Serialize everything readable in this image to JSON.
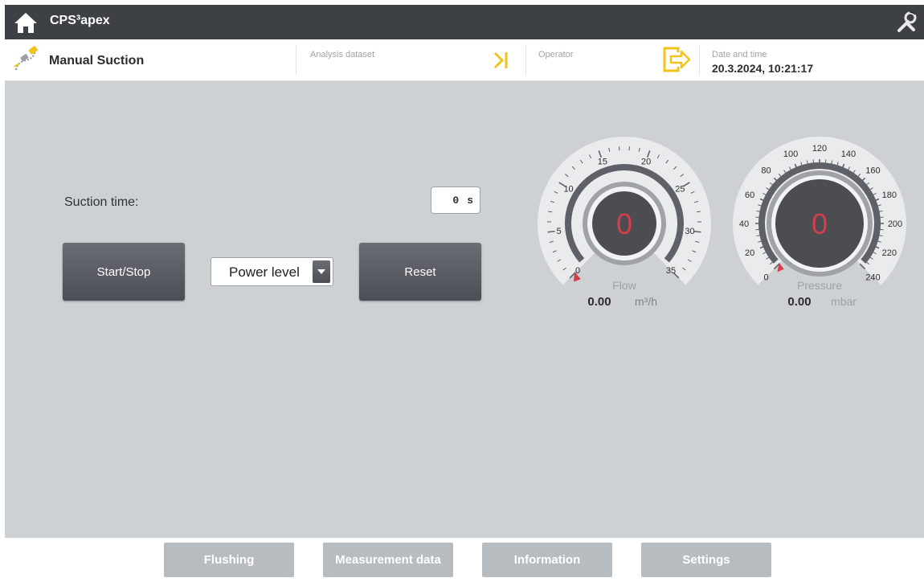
{
  "app": {
    "title": "CPS³apex"
  },
  "header": {
    "page_title": "Manual Suction",
    "analysis_dataset_label": "Analysis dataset",
    "operator_label": "Operator",
    "datetime_label": "Date and time",
    "datetime_value": "20.3.2024, 10:21:17"
  },
  "suction": {
    "label": "Suction time:",
    "time_value": "0",
    "time_unit": "s"
  },
  "controls": {
    "start_stop_label": "Start/Stop",
    "power_level_value": "Power level",
    "reset_label": "Reset"
  },
  "flow_gauge": {
    "title": "Flow",
    "center_value": "0",
    "readout_value": "0.00",
    "unit": "m³/h",
    "ticks": [
      "0",
      "5",
      "10",
      "15",
      "20",
      "25",
      "30",
      "35"
    ],
    "min": 0,
    "max": 35,
    "current": 0
  },
  "pressure_gauge": {
    "title": "Pressure",
    "center_value": "0",
    "readout_value": "0.00",
    "unit": "mbar",
    "ticks": [
      "0",
      "20",
      "40",
      "60",
      "80",
      "100",
      "120",
      "140",
      "160",
      "180",
      "200",
      "220",
      "240"
    ],
    "min": 0,
    "max": 240,
    "current": 0
  },
  "nav": {
    "flushing": "Flushing",
    "measurement_data": "Measurement data",
    "information": "Information",
    "settings": "Settings"
  },
  "colors": {
    "accent_yellow": "#f2c31b",
    "title_bar": "#3d4045",
    "gauge_value_red": "#d43d4a"
  }
}
